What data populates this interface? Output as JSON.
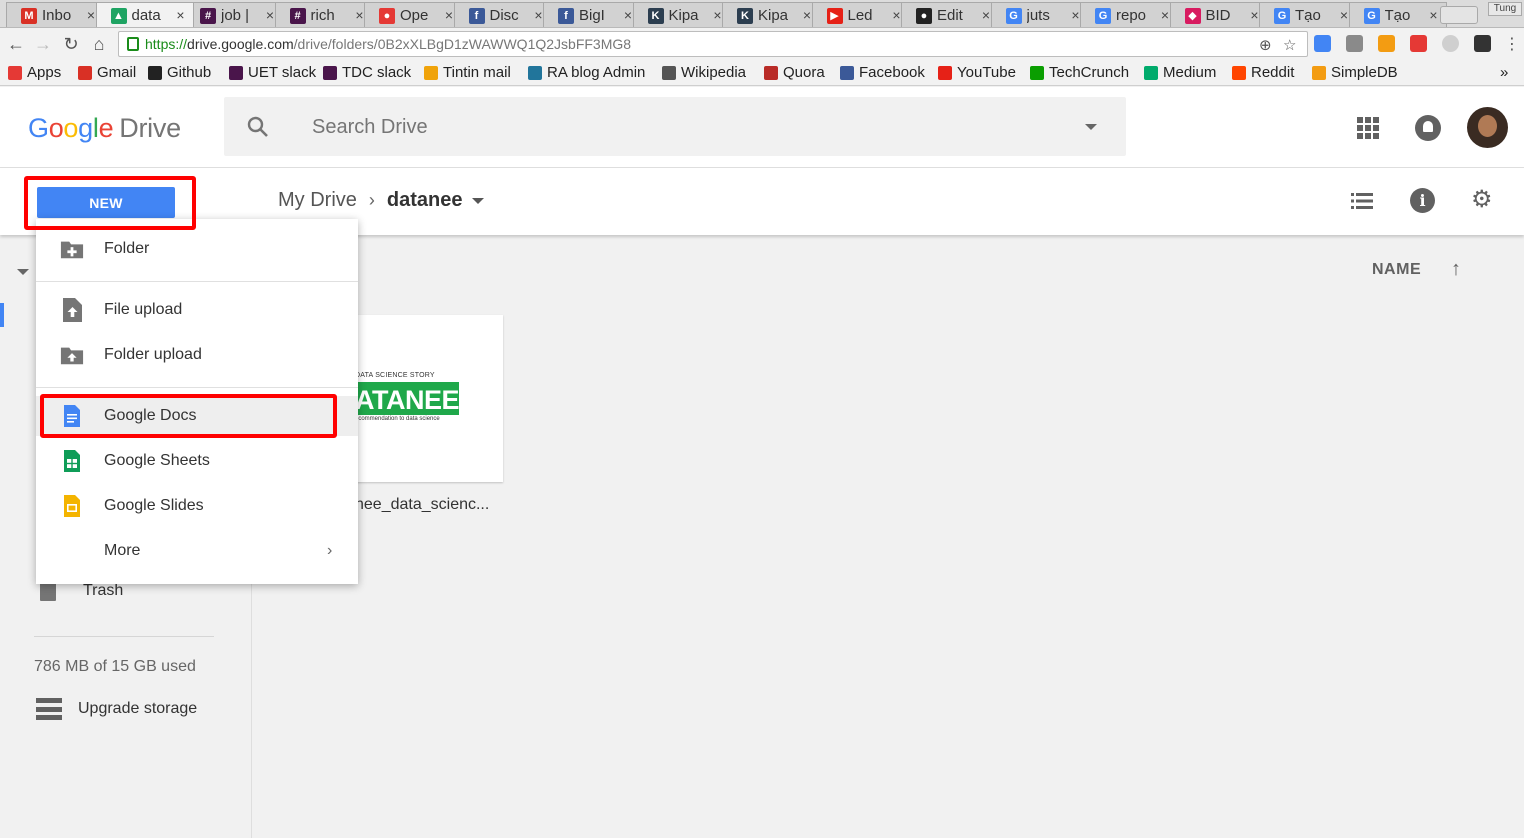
{
  "browser": {
    "tabs": [
      {
        "title": "Inbo",
        "icon": "gmail-icon",
        "color": "#d93025",
        "glyph": "M"
      },
      {
        "title": "data",
        "icon": "drive-icon",
        "color": "#1fa463",
        "glyph": "▲",
        "active": true
      },
      {
        "title": "job |",
        "icon": "slack-icon",
        "color": "#4a154b",
        "glyph": "#"
      },
      {
        "title": "rich",
        "icon": "slack-icon",
        "color": "#4a154b",
        "glyph": "#"
      },
      {
        "title": "Ope",
        "icon": "pokeball-icon",
        "color": "#e53935",
        "glyph": "●"
      },
      {
        "title": "Disc",
        "icon": "facebook-icon",
        "color": "#3b5998",
        "glyph": "f"
      },
      {
        "title": "BigI",
        "icon": "facebook-icon",
        "color": "#3b5998",
        "glyph": "f"
      },
      {
        "title": "Kipa",
        "icon": "kipalog-icon",
        "color": "#2c3e50",
        "glyph": "K"
      },
      {
        "title": "Kipa",
        "icon": "kipalog-icon",
        "color": "#2c3e50",
        "glyph": "K"
      },
      {
        "title": "Led",
        "icon": "youtube-icon",
        "color": "#e62117",
        "glyph": "▶"
      },
      {
        "title": "Edit",
        "icon": "github-icon",
        "color": "#222222",
        "glyph": "●"
      },
      {
        "title": "juts",
        "icon": "google-icon",
        "color": "#4285f4",
        "glyph": "G"
      },
      {
        "title": "repo",
        "icon": "google-icon",
        "color": "#4285f4",
        "glyph": "G"
      },
      {
        "title": "BID",
        "icon": "bidv-icon",
        "color": "#d81b60",
        "glyph": "◆"
      },
      {
        "title": "Tạo",
        "icon": "google-icon",
        "color": "#4285f4",
        "glyph": "G"
      },
      {
        "title": "Tạo",
        "icon": "google-icon",
        "color": "#4285f4",
        "glyph": "G"
      }
    ],
    "profile_name": "Tung",
    "url": {
      "protocol": "https://",
      "host": "drive.google.com",
      "path": "/drive/folders/0B2xXLBgD1zWAWWQ1Q2JsbFF3MG8"
    },
    "bookmarks": [
      {
        "label": "Apps",
        "icon": "apps-grid-icon",
        "color": "#e53935"
      },
      {
        "label": "Gmail",
        "icon": "gmail-icon",
        "color": "#d93025"
      },
      {
        "label": "Github",
        "icon": "github-icon",
        "color": "#222222"
      },
      {
        "label": "UET slack",
        "icon": "slack-icon",
        "color": "#4a154b"
      },
      {
        "label": "TDC slack",
        "icon": "slack-icon",
        "color": "#4a154b"
      },
      {
        "label": "Tintin mail",
        "icon": "mail-icon",
        "color": "#f0a30a"
      },
      {
        "label": "RA blog Admin",
        "icon": "wordpress-icon",
        "color": "#21759b"
      },
      {
        "label": "Wikipedia",
        "icon": "wikipedia-icon",
        "color": "#555555"
      },
      {
        "label": "Quora",
        "icon": "quora-icon",
        "color": "#b92b27"
      },
      {
        "label": "Facebook",
        "icon": "facebook-icon",
        "color": "#3b5998"
      },
      {
        "label": "YouTube",
        "icon": "youtube-icon",
        "color": "#e62117"
      },
      {
        "label": "TechCrunch",
        "icon": "techcrunch-icon",
        "color": "#0a9e01"
      },
      {
        "label": "Medium",
        "icon": "medium-icon",
        "color": "#00ab6c"
      },
      {
        "label": "Reddit",
        "icon": "reddit-icon",
        "color": "#ff4500"
      },
      {
        "label": "SimpleDB",
        "icon": "simpledb-icon",
        "color": "#f39c12"
      }
    ],
    "overflow_label": "»"
  },
  "drive": {
    "logo_google": [
      "G",
      "o",
      "o",
      "g",
      "l",
      "e"
    ],
    "logo_product": "Drive",
    "search_placeholder": "Search Drive",
    "new_button": "NEW",
    "breadcrumb": {
      "root": "My Drive",
      "separator": "›",
      "current": "datanee"
    },
    "sort_label": "NAME",
    "sort_arrow": "↑",
    "sidebar": {
      "trash": "Trash",
      "storage": "786 MB of 15 GB used",
      "upgrade": "Upgrade storage"
    },
    "file": {
      "thumb_top": "DATA SCIENCE STORY",
      "thumb_word": "ATANEE",
      "thumb_sub": "ecommendation to data science",
      "name": "nee_data_scienc..."
    },
    "new_menu": {
      "folder": "Folder",
      "file_upload": "File upload",
      "folder_upload": "Folder upload",
      "docs": "Google Docs",
      "sheets": "Google Sheets",
      "slides": "Google Slides",
      "more": "More"
    },
    "colors": {
      "accent": "#4285f4",
      "docs": "#4285f4",
      "sheets": "#0f9d58",
      "slides": "#f4b400",
      "annotation": "#ff0000"
    }
  }
}
